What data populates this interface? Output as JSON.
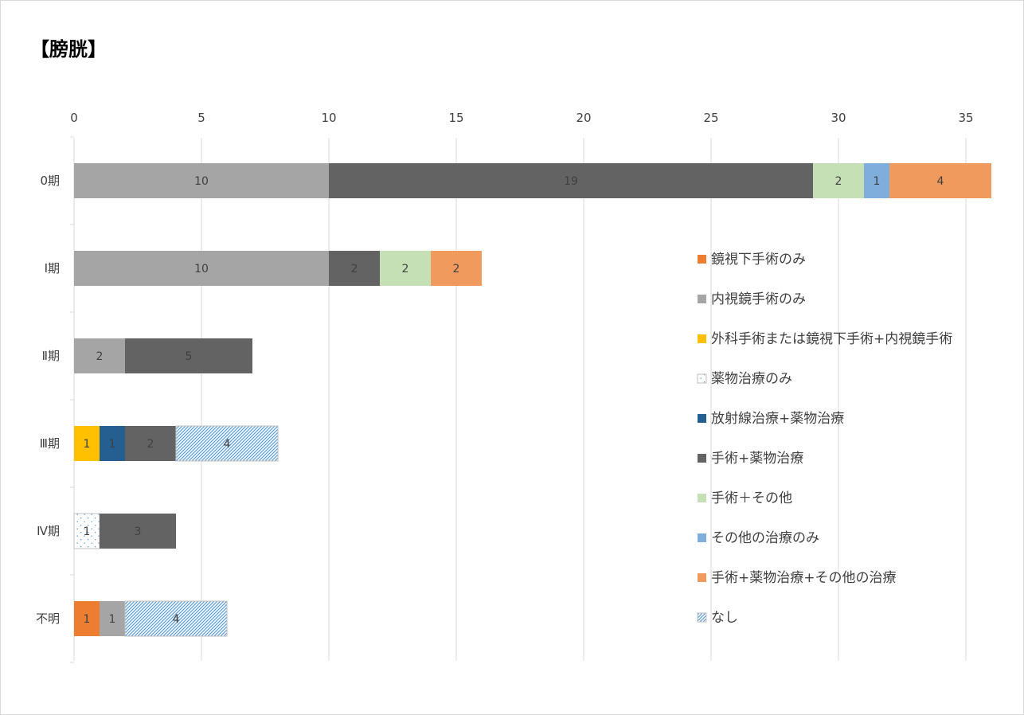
{
  "chart_data": {
    "type": "bar",
    "orientation": "horizontal",
    "stacked": true,
    "title": "【膀胱】",
    "xlim": [
      0,
      35
    ],
    "x_ticks": [
      0,
      5,
      10,
      15,
      20,
      25,
      30,
      35
    ],
    "x_axis_position": "top",
    "grid": true,
    "legend_position": "right",
    "categories": [
      "0期",
      "Ⅰ期",
      "Ⅱ期",
      "Ⅲ期",
      "Ⅳ期",
      "不明"
    ],
    "series": [
      {
        "name": "鏡視下手術のみ",
        "color": "#ED7D31",
        "pattern": "solid",
        "values": [
          0,
          0,
          0,
          0,
          0,
          1
        ]
      },
      {
        "name": "内視鏡手術のみ",
        "color": "#A5A5A5",
        "pattern": "solid",
        "values": [
          10,
          10,
          2,
          0,
          0,
          1
        ]
      },
      {
        "name": "外科手術または鏡視下手術+内視鏡手術",
        "color": "#FFC000",
        "pattern": "solid",
        "values": [
          0,
          0,
          0,
          1,
          0,
          0
        ]
      },
      {
        "name": "薬物治療のみ",
        "color": "#5B9BD5",
        "pattern": "dots",
        "values": [
          0,
          0,
          0,
          0,
          1,
          0
        ]
      },
      {
        "name": "放射線治療+薬物治療",
        "color": "#255E91",
        "pattern": "solid",
        "values": [
          0,
          0,
          0,
          1,
          0,
          0
        ]
      },
      {
        "name": "手術+薬物治療",
        "color": "#636363",
        "pattern": "solid",
        "values": [
          19,
          2,
          5,
          2,
          3,
          0
        ]
      },
      {
        "name": "手術＋その他",
        "color": "#C5E0B4",
        "pattern": "solid",
        "values": [
          2,
          2,
          0,
          0,
          0,
          0
        ]
      },
      {
        "name": "その他の治療のみ",
        "color": "#7FAEDD",
        "pattern": "solid",
        "values": [
          1,
          0,
          0,
          0,
          0,
          0
        ]
      },
      {
        "name": "手術+薬物治療+その他の治療",
        "color": "#F19A5E",
        "pattern": "solid",
        "values": [
          4,
          2,
          0,
          0,
          0,
          0
        ]
      },
      {
        "name": "なし",
        "color": "#5B9BD5",
        "pattern": "hatch",
        "values": [
          0,
          0,
          0,
          4,
          0,
          4
        ]
      }
    ]
  }
}
